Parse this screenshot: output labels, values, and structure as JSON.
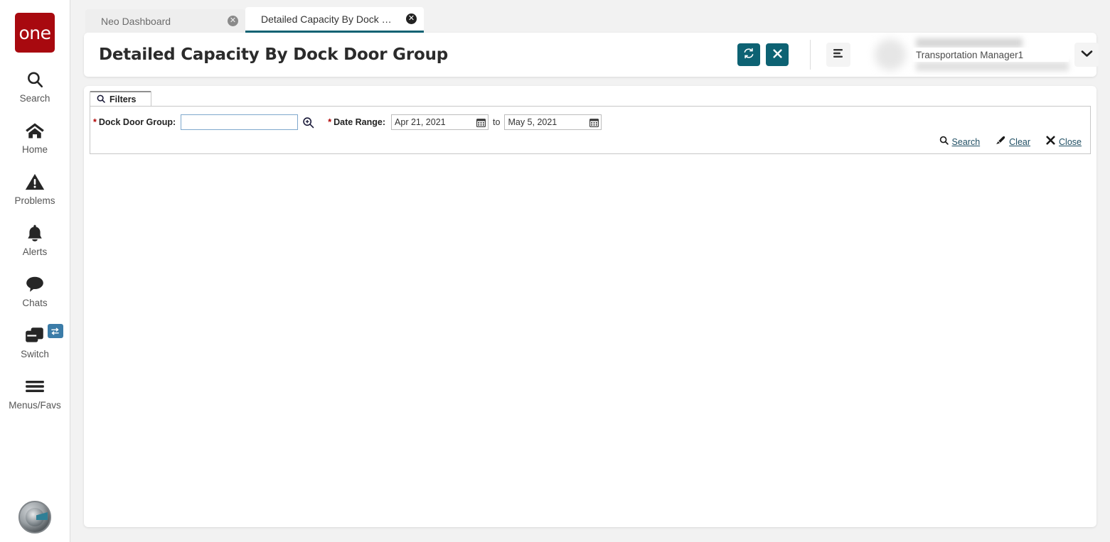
{
  "sidebar": {
    "logo_text": "one",
    "items": [
      {
        "label": "Search",
        "icon": "search-icon"
      },
      {
        "label": "Home",
        "icon": "home-icon"
      },
      {
        "label": "Problems",
        "icon": "warning-triangle-icon"
      },
      {
        "label": "Alerts",
        "icon": "bell-icon"
      },
      {
        "label": "Chats",
        "icon": "chat-bubble-icon"
      },
      {
        "label": "Switch",
        "icon": "switch-windows-icon",
        "badge_icon": "swap-arrows-icon"
      },
      {
        "label": "Menus/Favs",
        "icon": "hamburger-menu-icon"
      }
    ],
    "bottom_avatar_icon": "robot-head-avatar-icon"
  },
  "tabs": [
    {
      "label": "Neo Dashboard",
      "active": false,
      "close_icon": "close-circle-icon"
    },
    {
      "label": "Detailed Capacity By Dock Door ...",
      "active": true,
      "close_icon": "close-circle-icon"
    }
  ],
  "header": {
    "title": "Detailed Capacity By Dock Door Group",
    "refresh_icon": "refresh-icon",
    "close_icon": "close-x-icon",
    "menu_icon": "hamburger-menu-icon",
    "caret_icon": "chevron-down-icon",
    "user_role": "Transportation Manager1"
  },
  "filters": {
    "tab_label": "Filters",
    "tab_icon": "search-icon",
    "dock_door_group": {
      "required_mark": "*",
      "label": "Dock Door Group:",
      "value": "",
      "placeholder": "",
      "picker_icon": "magnifier-plus-icon"
    },
    "date_range": {
      "required_mark": "*",
      "label": "Date Range:",
      "from_value": "Apr 21, 2021",
      "to_word": "to",
      "to_value": "May 5, 2021",
      "calendar_icon": "calendar-icon"
    },
    "actions": [
      {
        "label": "Search",
        "icon": "search-icon"
      },
      {
        "label": "Clear",
        "icon": "eraser-icon"
      },
      {
        "label": "Close",
        "icon": "x-icon"
      }
    ]
  },
  "colors": {
    "brand_red": "#a8090f",
    "accent_teal": "#0d6273",
    "link_teal": "#1f4e63",
    "required_red": "#b00000",
    "focus_blue": "#7fa8cd",
    "page_bg": "#f2f2f2"
  }
}
